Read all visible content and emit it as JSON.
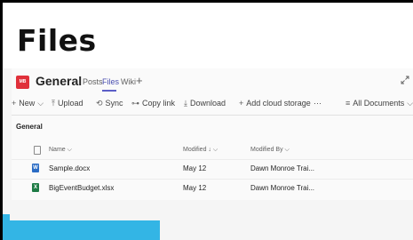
{
  "page": {
    "title": "Files"
  },
  "header": {
    "avatar_initials": "MB",
    "avatar_color": "#e0303a",
    "channel_name": "General",
    "tabs": [
      {
        "label": "Posts",
        "active": false
      },
      {
        "label": "Files",
        "active": true
      },
      {
        "label": "Wiki",
        "active": false
      }
    ],
    "add_tab_icon": "plus-icon",
    "expand_icon": "expand-icon"
  },
  "toolbar": {
    "new_label": "New",
    "upload_label": "Upload",
    "sync_label": "Sync",
    "copy_link_label": "Copy link",
    "download_label": "Download",
    "add_cloud_label": "Add cloud storage",
    "more_label": "···",
    "view_label": "All Documents"
  },
  "library": {
    "section_label": "General",
    "columns": {
      "name": "Name",
      "modified": "Modified",
      "modified_by": "Modified By"
    },
    "files": [
      {
        "type": "word",
        "name": "Sample.docx",
        "modified": "May 12",
        "modified_by": "Dawn Monroe Trai..."
      },
      {
        "type": "excel",
        "name": "BigEventBudget.xlsx",
        "modified": "May 12",
        "modified_by": "Dawn Monroe Trai..."
      }
    ]
  },
  "colors": {
    "accent": "#5b5fc7",
    "brand_blue": "#33b5e5",
    "word": "#2b6cc4",
    "excel": "#1e7b45"
  }
}
